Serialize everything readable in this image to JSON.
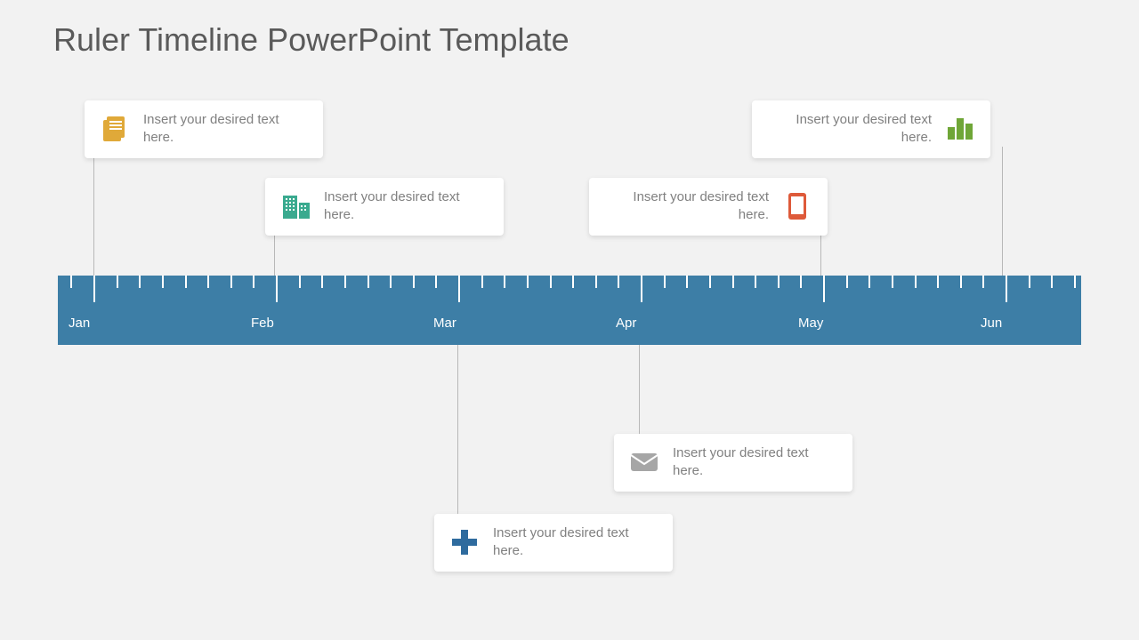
{
  "title": "Ruler Timeline PowerPoint Template",
  "months": [
    "Jan",
    "Feb",
    "Mar",
    "Apr",
    "May",
    "Jun"
  ],
  "cards": {
    "c1": {
      "text": "Insert your desired text here."
    },
    "c2": {
      "text": "Insert your desired text here."
    },
    "c3": {
      "text": "Insert your desired text here."
    },
    "c4": {
      "text": "Insert your desired text here."
    },
    "c5": {
      "text": "Insert your desired text here."
    },
    "c6": {
      "text": "Insert your desired text here."
    }
  },
  "colors": {
    "ruler": "#3d7ea6",
    "icon1": "#e0a939",
    "icon2": "#3aaa8f",
    "icon3": "#de5a3a",
    "icon4": "#6fa637",
    "icon5": "#a6a6a6",
    "icon6": "#2e6b9e"
  }
}
